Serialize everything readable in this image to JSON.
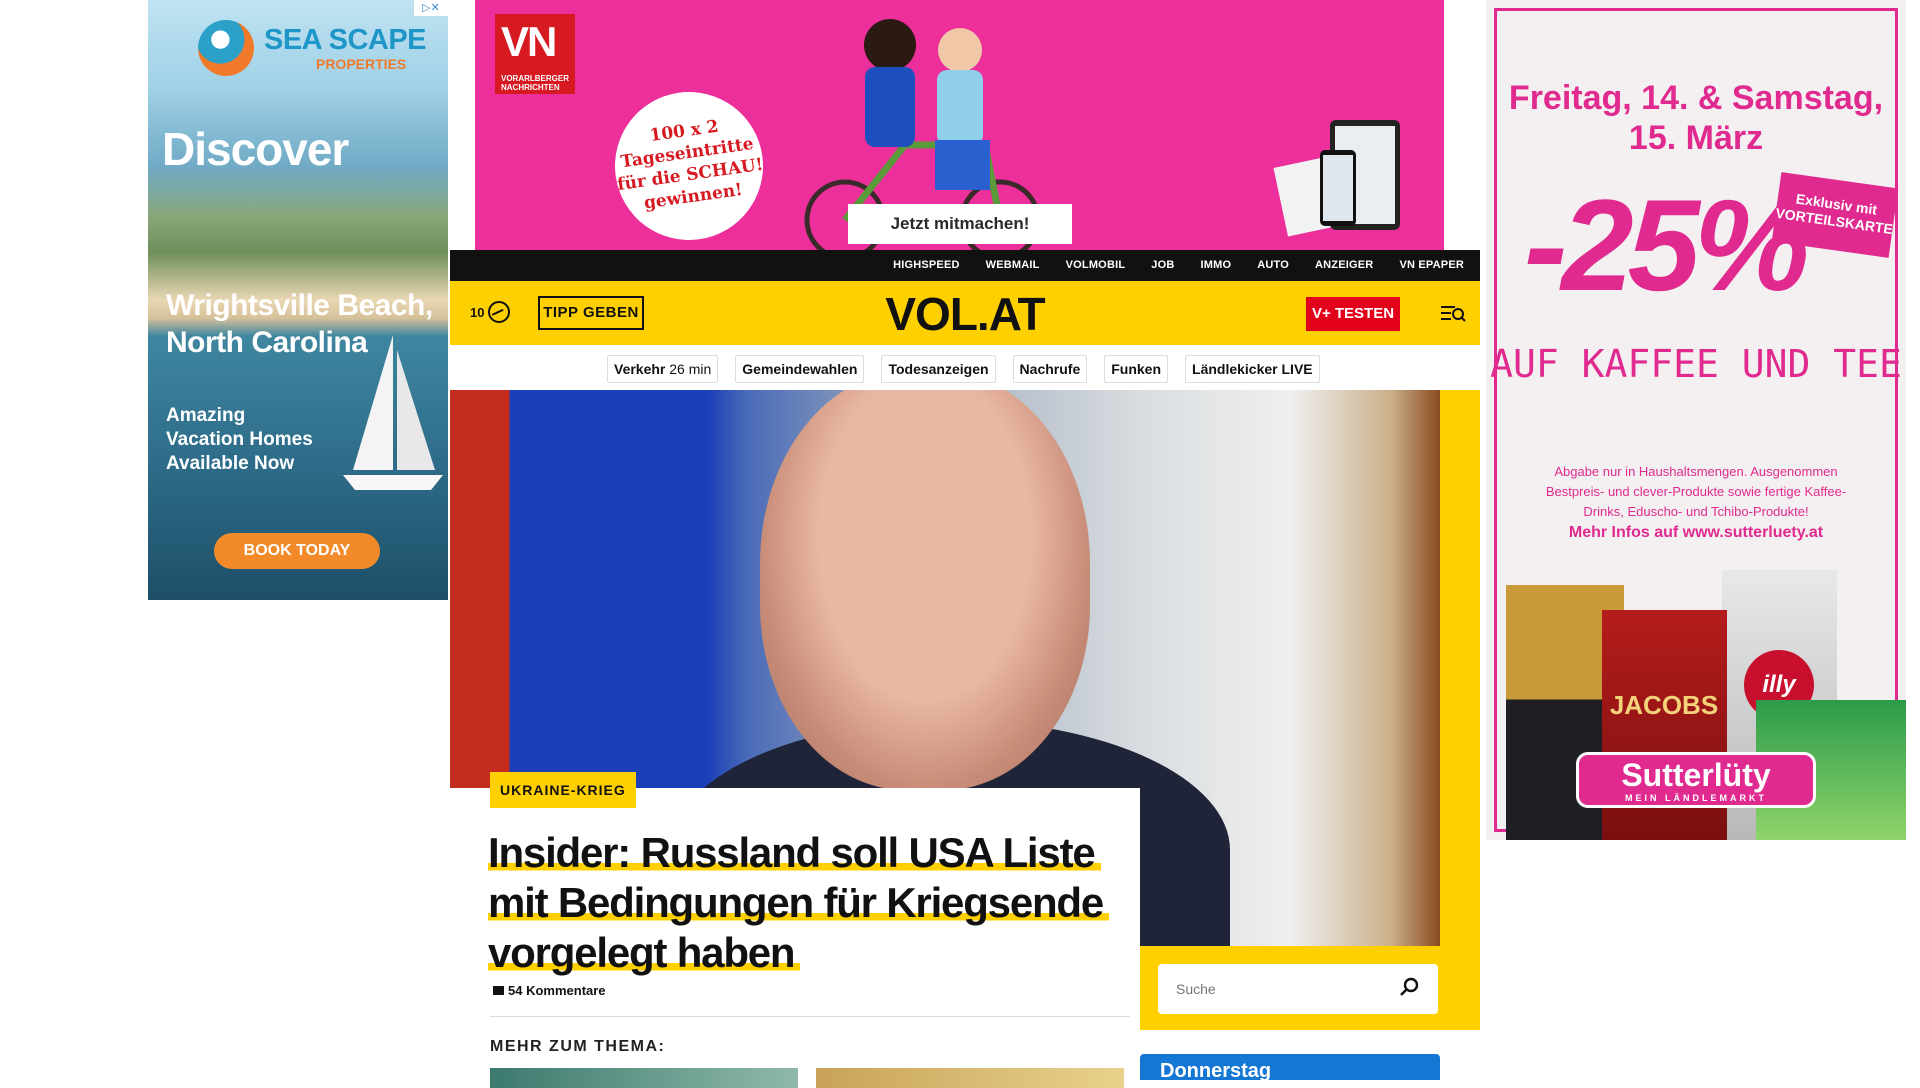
{
  "ad_left": {
    "brand_name": "SEA SCAPE",
    "brand_sub": "PROPERTIES",
    "headline": "Discover",
    "location": "Wrightsville Beach, North Carolina",
    "tagline": "Amazing Vacation Homes Available Now",
    "cta": "BOOK TODAY",
    "ad_marker": "▷✕"
  },
  "ad_top": {
    "logo": "VN",
    "logo_sub": "VORARLBERGER NACHRICHTEN",
    "offer": "100 x 2 Tageseintritte für die SCHAU! gewinnen!",
    "cta": "Jetzt mitmachen!"
  },
  "ad_right": {
    "date": "Freitag, 14. & Samstag, 15. März",
    "discount": "-25%",
    "badge": "Exklusiv mit VORTEILSKARTE",
    "headline": "AUF KAFFEE UND TEE",
    "note": "Abgabe nur in Haushaltsmengen. Ausgenommen Bestpreis- und clever-Produkte sowie fertige Kaffee-Drinks, Eduscho- und Tchibo-Produkte!",
    "info": "Mehr Infos auf www.sutterluety.at",
    "product_brand_1": "JACOBS",
    "product_brand_2": "illy",
    "store": "Sutterlüty",
    "store_sub": "MEIN LÄNDLEMARKT"
  },
  "topnav": [
    "HIGHSPEED",
    "WEBMAIL",
    "VOLMOBIL",
    "JOB",
    "IMMO",
    "AUTO",
    "ANZEIGER",
    "VN EPAPER"
  ],
  "header": {
    "temperature": "10",
    "tipp": "TIPP GEBEN",
    "logo": "VOL.AT",
    "vplus": "V+ TESTEN"
  },
  "quicklinks": [
    {
      "label": "Verkehr",
      "meta": "26 min"
    },
    {
      "label": "Gemeindewahlen",
      "meta": ""
    },
    {
      "label": "Todesanzeigen",
      "meta": ""
    },
    {
      "label": "Nachrufe",
      "meta": ""
    },
    {
      "label": "Funken",
      "meta": ""
    },
    {
      "label": "Ländlekicker LIVE",
      "meta": ""
    }
  ],
  "article": {
    "kicker": "UKRAINE-KRIEG",
    "headline": "Insider: Russland soll USA Liste mit Bedingungen für Kriegsende vorgelegt haben",
    "comments": "54 Kommentare",
    "more": "MEHR ZUM THEMA:"
  },
  "search": {
    "placeholder": "Suche"
  },
  "weather_widget": {
    "day": "Donnerstag"
  },
  "colors": {
    "brand_yellow": "#ffd000",
    "vplus_red": "#e2001a",
    "ad_pink": "#ec2f9a",
    "weather_blue": "#1577d4"
  }
}
